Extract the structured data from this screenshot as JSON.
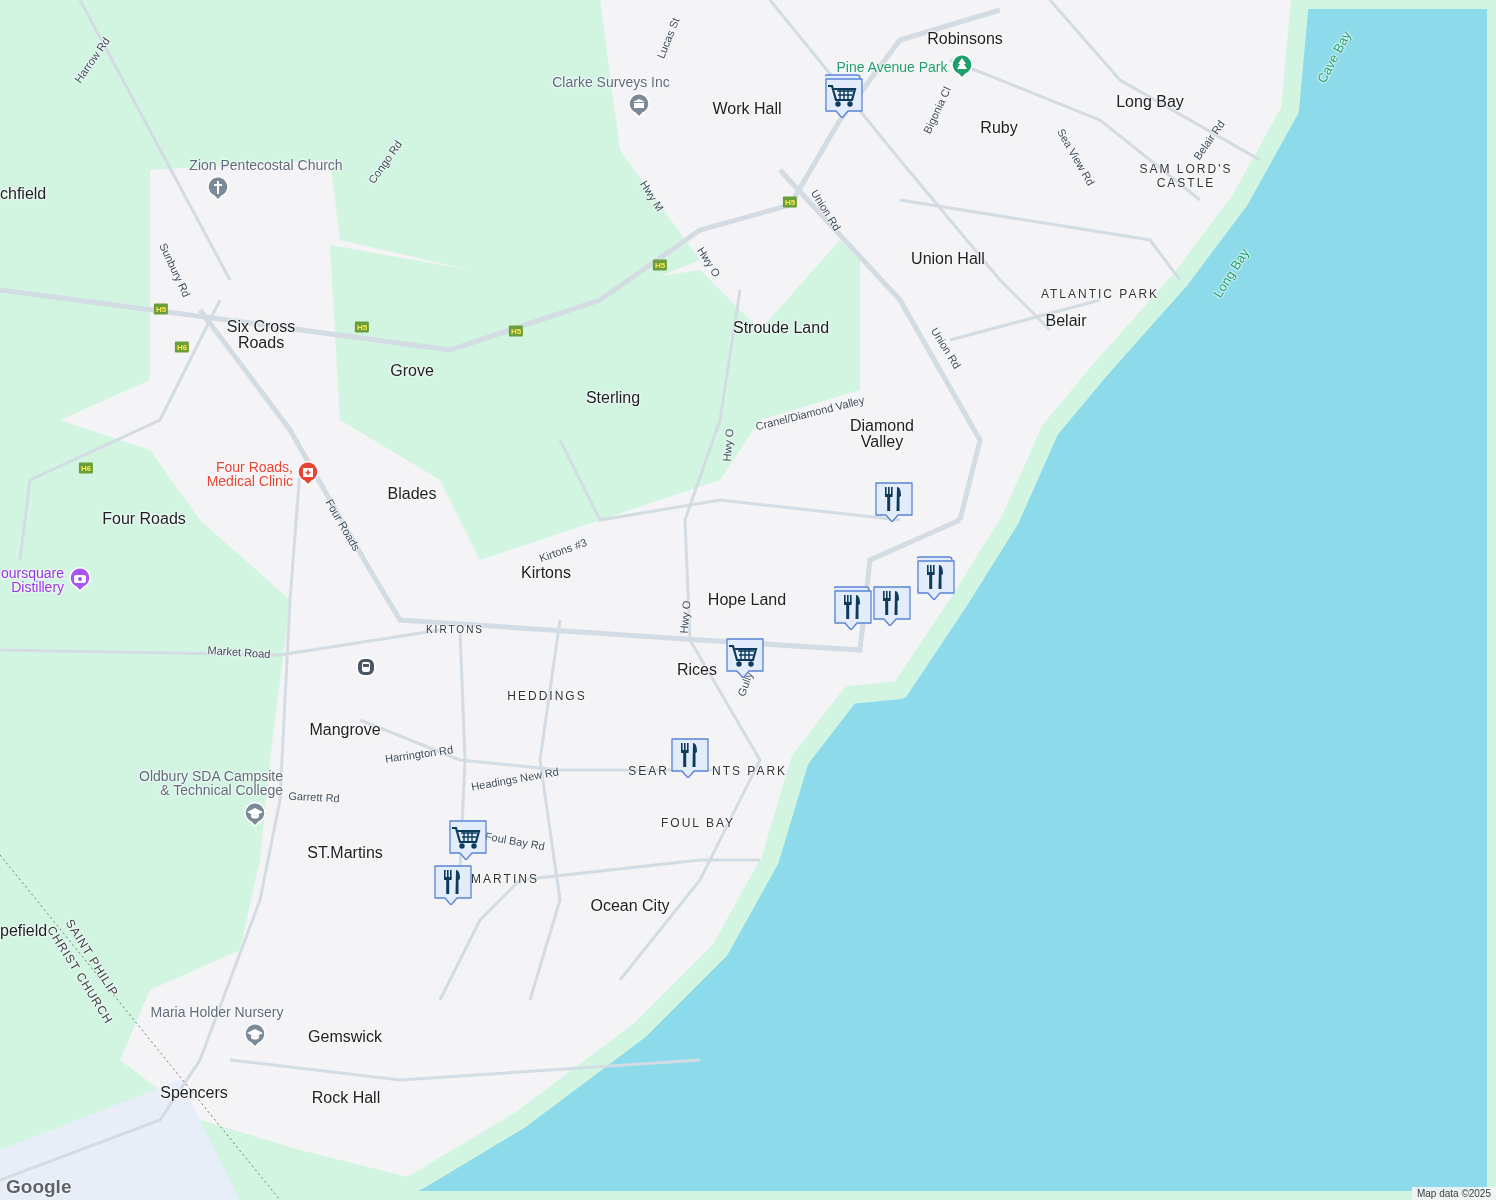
{
  "map": {
    "places": [
      "Robinsons",
      "Work Hall",
      "Ruby",
      "Long Bay",
      "chfield",
      "Union Hall",
      "Belair",
      "Six Cross Roads",
      "Stroude Land",
      "Grove",
      "Sterling",
      "Diamond Valley",
      "Blades",
      "Four Roads",
      "Kirtons",
      "Hope Land",
      "Rices",
      "Mangrove",
      "ST.Martins",
      "Ocean City",
      "pefield",
      "Gemswick",
      "Spencers",
      "Rock Hall"
    ],
    "districts": [
      "SAM LORD'S CASTLE",
      "ATLANTIC PARK",
      "KIRTONS",
      "HEDDINGS",
      "SEAR",
      "NTS PARK",
      "FOUL BAY",
      "MARTINS"
    ],
    "boundary_labels": [
      "SAINT PHILIP",
      "CHRIST CHURCH"
    ],
    "roads": [
      "Harrow Rd",
      "Lucas St",
      "Congo Rd",
      "Sunbury Rd",
      "Hwy M",
      "Hwy O",
      "Union Rd",
      "Bigonia Cl",
      "Sea View Rd",
      "Belair Rd",
      "Union Rd",
      "Cranel/Diamond Valley",
      "Hwy O",
      "Kirtons #3",
      "Four Roads",
      "Hwy O",
      "Market Road",
      "Gully",
      "Harrington Rd",
      "Headings New Rd",
      "Garrett Rd",
      "Foul Bay Rd"
    ],
    "water_labels": [
      "Cave Bay",
      "Long Bay"
    ],
    "pois": [
      {
        "kind": "church",
        "lines": [
          "Zion Pentecostal Church"
        ]
      },
      {
        "kind": "survey",
        "lines": [
          "Clarke Surveys Inc"
        ]
      },
      {
        "kind": "park",
        "lines": [
          "Pine Avenue Park"
        ]
      },
      {
        "kind": "clinic",
        "lines": [
          "Four Roads,",
          "Medical Clinic"
        ]
      },
      {
        "kind": "attraction",
        "lines": [
          "oursquare",
          "Distillery"
        ]
      },
      {
        "kind": "bus"
      },
      {
        "kind": "school",
        "lines": [
          "Oldbury SDA Campsite",
          "& Technical College"
        ]
      },
      {
        "kind": "school",
        "lines": [
          "Maria Holder Nursery"
        ]
      }
    ],
    "highway_shields": [
      "H5",
      "H6",
      "H5",
      "H5",
      "H5",
      "H5",
      "H6"
    ],
    "markers": [
      {
        "kind": "shopping",
        "stacked": true
      },
      {
        "kind": "restaurant",
        "stacked": false
      },
      {
        "kind": "restaurant",
        "stacked": true
      },
      {
        "kind": "restaurant",
        "stacked": true
      },
      {
        "kind": "restaurant",
        "stacked": false
      },
      {
        "kind": "shopping",
        "stacked": false
      },
      {
        "kind": "restaurant",
        "stacked": false
      },
      {
        "kind": "shopping",
        "stacked": false
      },
      {
        "kind": "restaurant",
        "stacked": false
      }
    ]
  },
  "logo": "Google",
  "attribution": "Map data ©2025"
}
